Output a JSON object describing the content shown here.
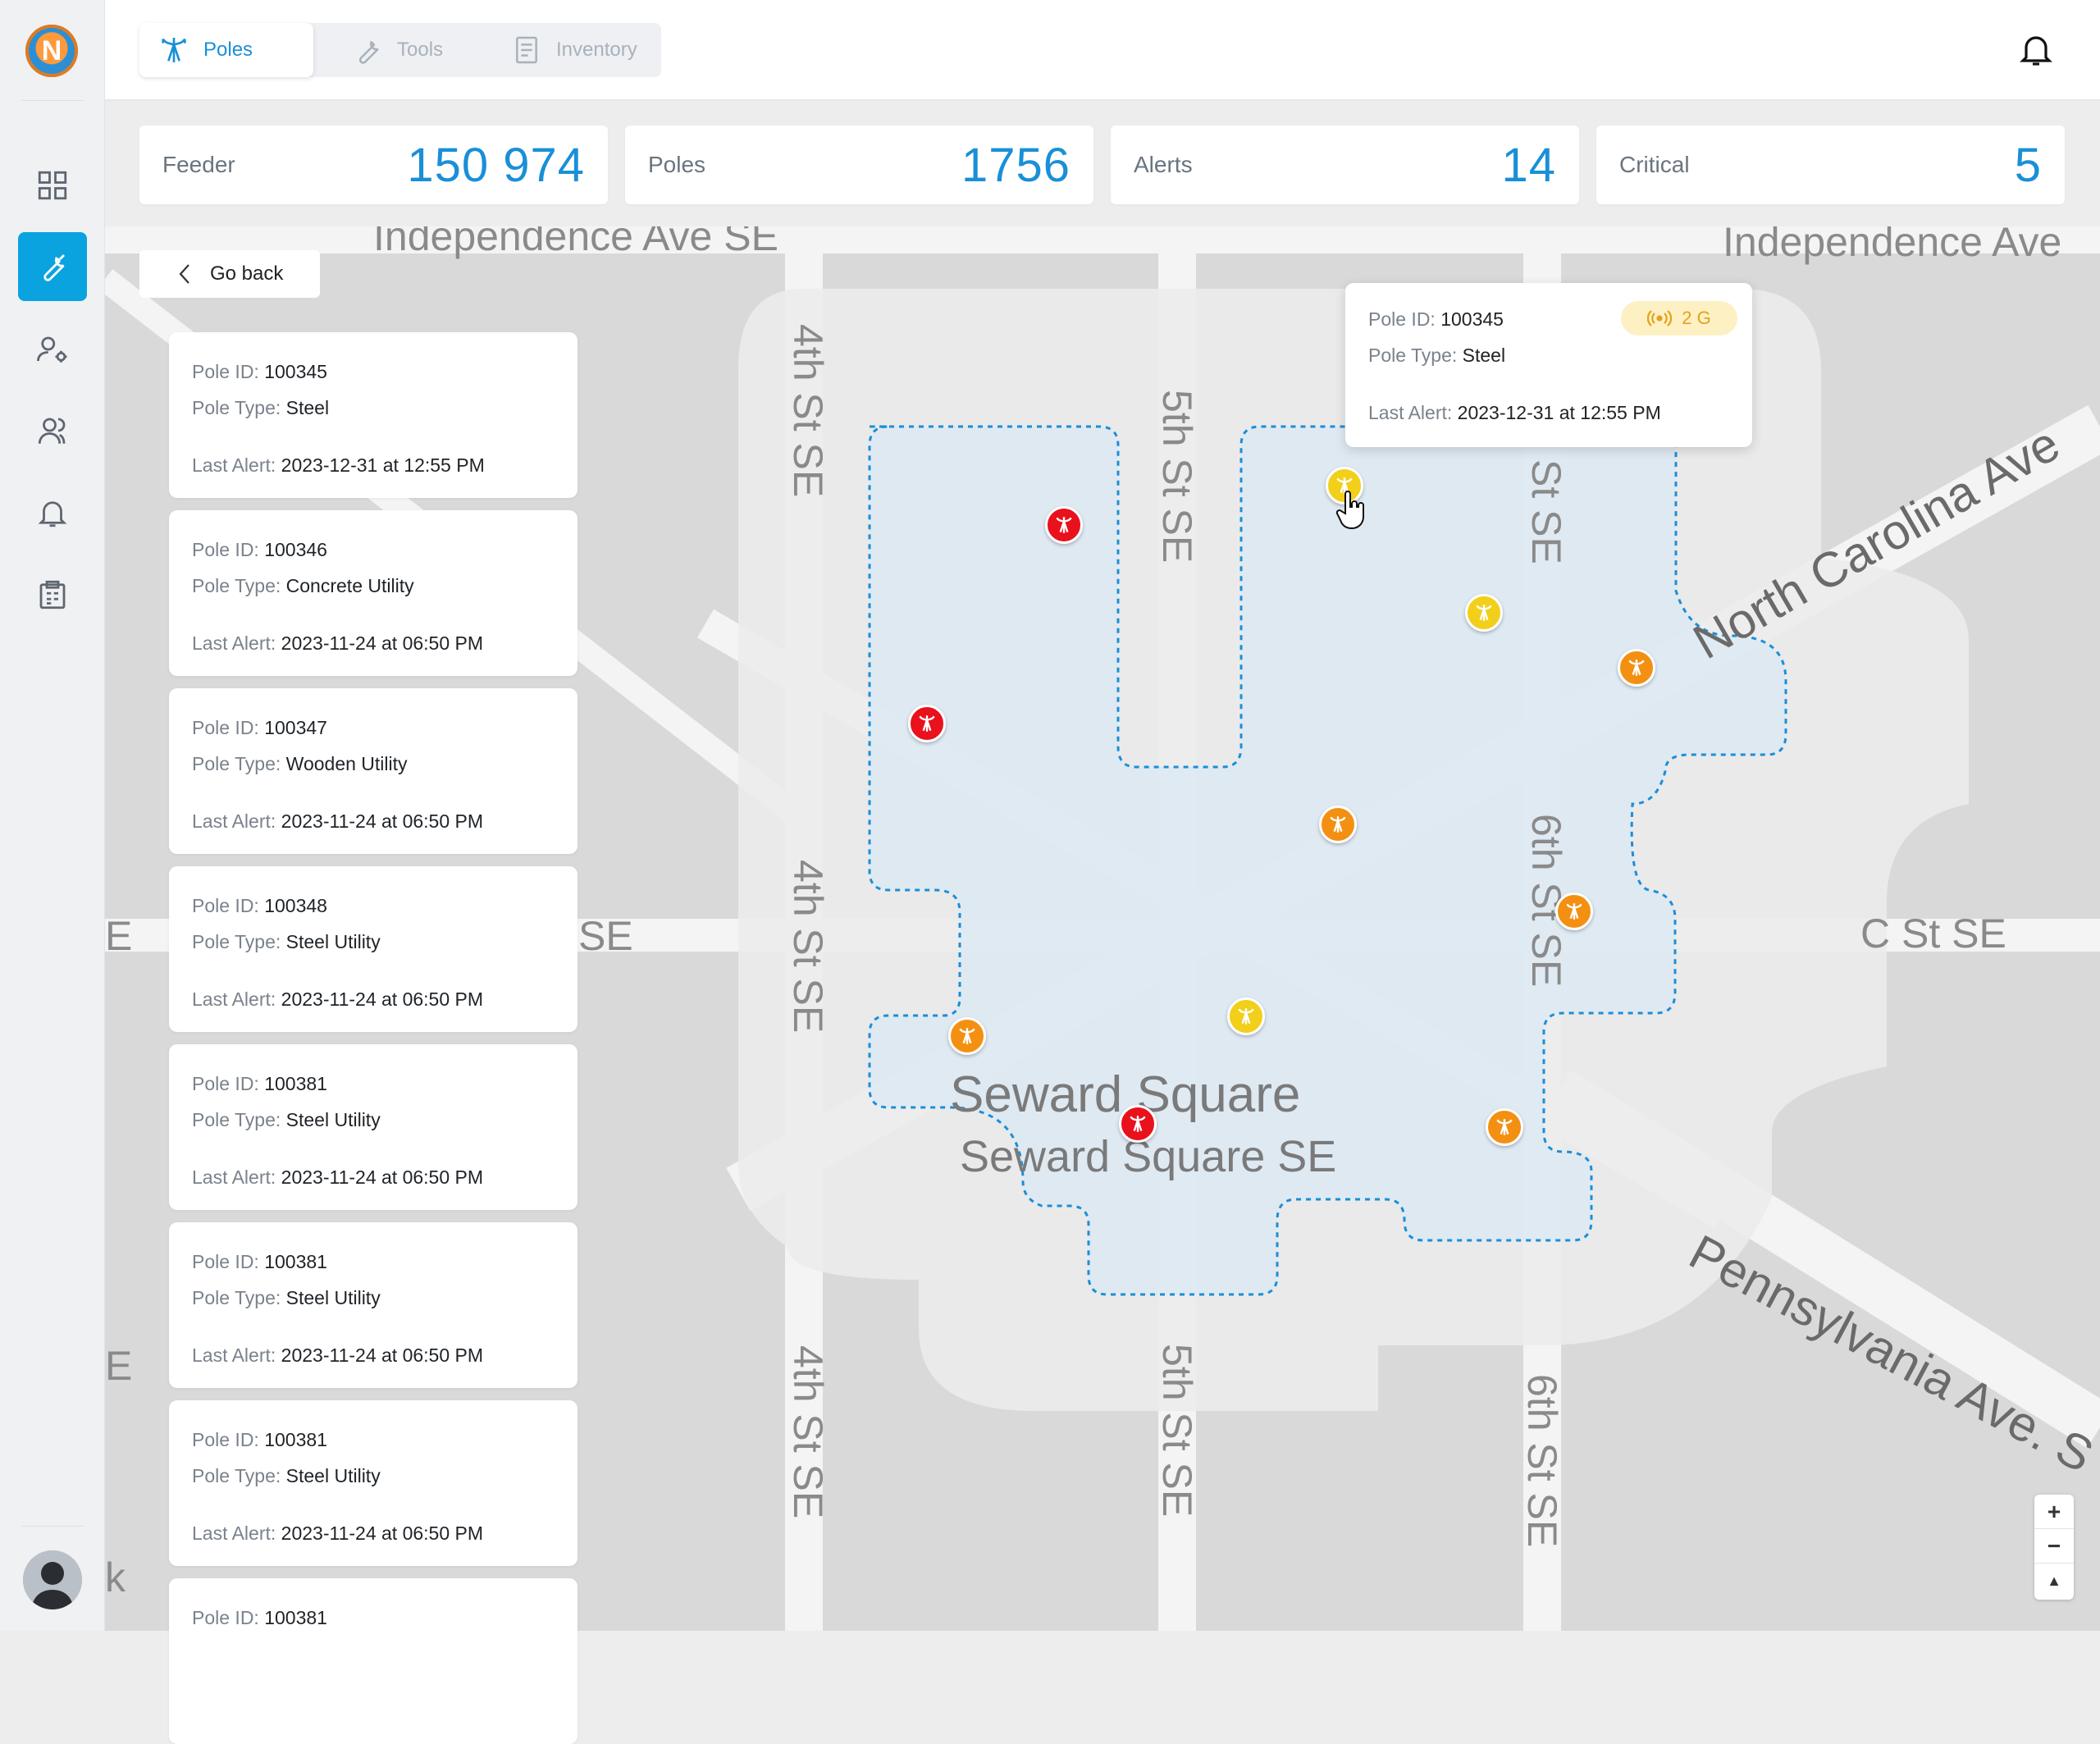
{
  "tabs": [
    {
      "label": "Poles",
      "icon": "antenna-icon"
    },
    {
      "label": "Tools",
      "icon": "wrench-icon"
    },
    {
      "label": "Inventory",
      "icon": "clipboard-icon"
    }
  ],
  "stats": [
    {
      "label": "Feeder",
      "value": "150 974"
    },
    {
      "label": "Poles",
      "value": "1756"
    },
    {
      "label": "Alerts",
      "value": "14"
    },
    {
      "label": "Critical",
      "value": "5"
    }
  ],
  "go_back": "Go back",
  "field_labels": {
    "pole_id": "Pole ID:",
    "pole_type": "Pole Type:",
    "last_alert": "Last Alert:"
  },
  "poles": [
    {
      "id": "100345",
      "type": "Steel",
      "alert": "2023-12-31 at 12:55 PM"
    },
    {
      "id": "100346",
      "type": "Concrete Utility",
      "alert": "2023-11-24 at 06:50 PM"
    },
    {
      "id": "100347",
      "type": "Wooden Utility",
      "alert": "2023-11-24 at 06:50 PM"
    },
    {
      "id": "100348",
      "type": "Steel Utility",
      "alert": "2023-11-24 at 06:50 PM"
    },
    {
      "id": "100381",
      "type": "Steel Utility",
      "alert": "2023-11-24 at 06:50 PM"
    },
    {
      "id": "100381",
      "type": "Steel Utility",
      "alert": "2023-11-24 at 06:50 PM"
    },
    {
      "id": "100381",
      "type": "Steel Utility",
      "alert": "2023-11-24 at 06:50 PM"
    },
    {
      "id": "100381"
    }
  ],
  "popup": {
    "id": "100345",
    "type": "Steel",
    "alert": "2023-12-31 at 12:55 PM",
    "badge": "2 G"
  },
  "map_labels": {
    "independence_left": "Independence Ave SE",
    "independence_right": "Independence Ave",
    "fourth_st": "4th St SE",
    "fifth_st": "5th St SE",
    "sixth_st": "6th St SE",
    "st_se": "St SE",
    "north_carolina": "North Carolina Ave",
    "pennsylvania": "Pennsylvania Ave. S",
    "c_st": "C St SE",
    "se_left": "SE",
    "seward_square": "Seward Square",
    "seward_square_se": "Seward Square SE",
    "edge_e1": "E",
    "edge_e2": "E",
    "edge_k": "k"
  },
  "zoom": {
    "in": "+",
    "out": "−",
    "reset": "▲"
  },
  "colors": {
    "accent": "#1a8fd8",
    "active_nav": "#0aa3e0",
    "red": "#e8111c",
    "orange": "#f39012",
    "yellow": "#f2cf1a"
  }
}
